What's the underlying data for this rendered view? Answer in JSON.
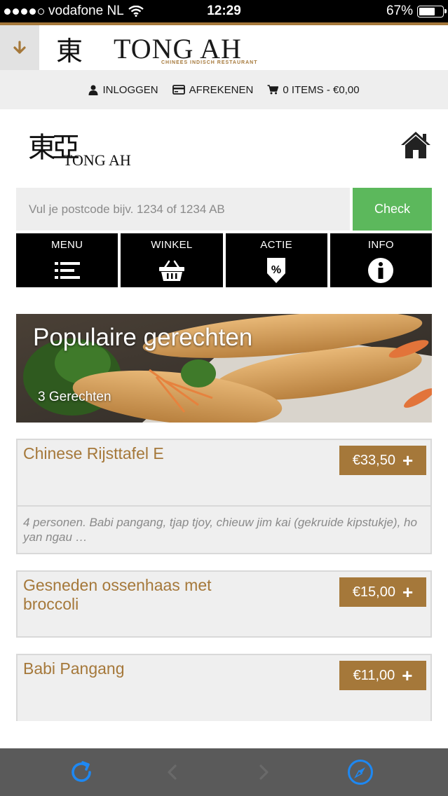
{
  "status_bar": {
    "carrier": "vodafone NL",
    "time": "12:29",
    "battery": "67%"
  },
  "app_header": {
    "brand_name": "TONG AH",
    "brand_glyph": "東亞",
    "brand_subtitle": "CHINEES INDISCH RESTAURANT"
  },
  "top_nav": {
    "login": "INLOGGEN",
    "checkout": "AFREKENEN",
    "cart": "0 ITEMS - €0,00"
  },
  "site_logo": {
    "glyph": "東亞",
    "name": "TONG AH"
  },
  "postcode": {
    "placeholder": "Vul je postcode bijv. 1234 of 1234 AB",
    "button": "Check"
  },
  "tiles": [
    {
      "label": "MENU",
      "icon": "list-icon"
    },
    {
      "label": "WINKEL",
      "icon": "basket-icon"
    },
    {
      "label": "ACTIE",
      "icon": "discount-tag-icon"
    },
    {
      "label": "INFO",
      "icon": "info-icon"
    }
  ],
  "banner": {
    "title": "Populaire gerechten",
    "count": "3 Gerechten"
  },
  "products": [
    {
      "name": "Chinese Rijsttafel E",
      "price": "€33,50",
      "description": "4 personen. Babi pangang, tjap tjoy, chieuw jim kai (gekruide kipstukje), ho yan ngau …"
    },
    {
      "name": "Gesneden ossenhaas met broccoli",
      "price": "€15,00"
    },
    {
      "name": "Babi Pangang",
      "price": "€11,00"
    }
  ],
  "colors": {
    "accent_gold": "#a5783a",
    "check_green": "#5cb85c",
    "tile_black": "#000000",
    "toolbar_gray": "#5a5a5a",
    "toolbar_blue": "#1e88f2"
  }
}
